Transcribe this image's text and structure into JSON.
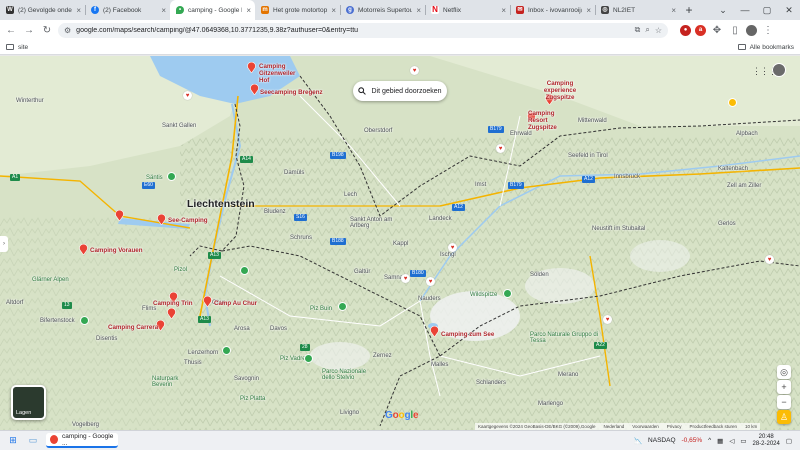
{
  "browser": {
    "tabs": [
      {
        "title": "(2) Gevolgde onderw",
        "favicon": "w-icon",
        "color": "#333333",
        "active": false
      },
      {
        "title": "(2) Facebook",
        "favicon": "facebook-icon",
        "color": "#1877f2",
        "active": false
      },
      {
        "title": "camping - Google M",
        "favicon": "google-maps-icon",
        "color": "#34a853",
        "active": true
      },
      {
        "title": "Het grote motortop",
        "favicon": "motor-icon",
        "color": "#e37400",
        "active": false
      },
      {
        "title": "Motorreis Supertou",
        "favicon": "globe-icon",
        "color": "#4a6fd1",
        "active": false
      },
      {
        "title": "Netflix",
        "favicon": "netflix-icon",
        "color": "#e50914",
        "active": false
      },
      {
        "title": "Inbox - ivovanrooij@",
        "favicon": "mail-icon",
        "color": "#c5221f",
        "active": false
      },
      {
        "title": "NL2IET",
        "favicon": "instagram-icon",
        "color": "#444444",
        "active": false
      }
    ],
    "url": "google.com/maps/search/camping/@47.0649368,10.3771235,9.38z?authuser=0&entry=ttu",
    "bookmarks": {
      "left": "site",
      "right": "Alle bookmarks"
    }
  },
  "map": {
    "search_area_label": "Dit gebied doorzoeken",
    "layers_label": "Lagen",
    "places": [
      {
        "name": "Liechtenstein",
        "kind": "big"
      },
      {
        "name": "Winterthur",
        "kind": "town"
      },
      {
        "name": "Sankt Gallen",
        "kind": "town"
      },
      {
        "name": "Säntis",
        "kind": "park"
      },
      {
        "name": "Oberstdorf",
        "kind": "town"
      },
      {
        "name": "Ehrwald",
        "kind": "town"
      },
      {
        "name": "Mittenwald",
        "kind": "town"
      },
      {
        "name": "Seefeld in Tirol",
        "kind": "town"
      },
      {
        "name": "Innsbruck",
        "kind": "town"
      },
      {
        "name": "Alpbach",
        "kind": "town"
      },
      {
        "name": "Kaltenbach",
        "kind": "town"
      },
      {
        "name": "Zell am Ziller",
        "kind": "town"
      },
      {
        "name": "Neustift im Stubaital",
        "kind": "town"
      },
      {
        "name": "Damüls",
        "kind": "town"
      },
      {
        "name": "Bludenz",
        "kind": "town"
      },
      {
        "name": "Schruns",
        "kind": "town"
      },
      {
        "name": "Sankt Anton am Arlberg",
        "kind": "town"
      },
      {
        "name": "Landeck",
        "kind": "town"
      },
      {
        "name": "Imst",
        "kind": "town"
      },
      {
        "name": "Lech",
        "kind": "town"
      },
      {
        "name": "Kappl",
        "kind": "town"
      },
      {
        "name": "Galtür",
        "kind": "town"
      },
      {
        "name": "Ischgl",
        "kind": "town"
      },
      {
        "name": "Samnaun",
        "kind": "town"
      },
      {
        "name": "Nauders",
        "kind": "town"
      },
      {
        "name": "Sölden",
        "kind": "town"
      },
      {
        "name": "Wildspitze",
        "kind": "park"
      },
      {
        "name": "Gerlos",
        "kind": "town"
      },
      {
        "name": "Merano",
        "kind": "town"
      },
      {
        "name": "Parco Naturale Gruppo di Tessa",
        "kind": "park"
      },
      {
        "name": "Marlengo",
        "kind": "town"
      },
      {
        "name": "Schlanders",
        "kind": "town"
      },
      {
        "name": "Malles",
        "kind": "town"
      },
      {
        "name": "Zernez",
        "kind": "town"
      },
      {
        "name": "Davos",
        "kind": "town"
      },
      {
        "name": "Piz Buin",
        "kind": "park"
      },
      {
        "name": "Piz Vadret",
        "kind": "park"
      },
      {
        "name": "Lenzerhorn",
        "kind": "town"
      },
      {
        "name": "Chur",
        "kind": "town"
      },
      {
        "name": "Flims",
        "kind": "town"
      },
      {
        "name": "Pizol",
        "kind": "park"
      },
      {
        "name": "Glärner Alpen",
        "kind": "park"
      },
      {
        "name": "Bifertenstock",
        "kind": "town"
      },
      {
        "name": "Arosa",
        "kind": "town"
      },
      {
        "name": "Savognin",
        "kind": "town"
      },
      {
        "name": "Naturpark Beverin",
        "kind": "park"
      },
      {
        "name": "Piz Platta",
        "kind": "park"
      },
      {
        "name": "Livigno",
        "kind": "town"
      },
      {
        "name": "Parco Nazionale dello Stelvio",
        "kind": "park"
      },
      {
        "name": "Vogelberg",
        "kind": "town"
      },
      {
        "name": "Thusis",
        "kind": "town"
      },
      {
        "name": "Disentis",
        "kind": "town"
      },
      {
        "name": "Altdorf",
        "kind": "town"
      }
    ],
    "campings": [
      {
        "name": "Camping Gitzenweiler Hof"
      },
      {
        "name": "Seecamping Bregenz"
      },
      {
        "name": "Camping experience Zugspitze"
      },
      {
        "name": "Camping Resort Zugspitze"
      },
      {
        "name": "See-Camping"
      },
      {
        "name": "Camping Vorauen"
      },
      {
        "name": "Camping Trin"
      },
      {
        "name": "Camp Au Chur"
      },
      {
        "name": "Camping Carrera"
      },
      {
        "name": "Camping zum See"
      }
    ],
    "roads": [
      "B179",
      "B179",
      "A12",
      "A12",
      "A13",
      "A13",
      "A14",
      "A1",
      "S16",
      "B180",
      "13",
      "28",
      "E60",
      "B188",
      "B198",
      "A22"
    ],
    "attribution": [
      "Kaartgegevens ©2024 GeoBasis-DE/BKG (©2009),Google",
      "Nederland",
      "Voorwaarden",
      "Privacy",
      "Productfeedback sturen",
      "10 km"
    ]
  },
  "taskbar": {
    "chrome_label": "camping - Google ...",
    "ticker_name": "NASDAQ",
    "ticker_value": "-0,65%",
    "time": "20:48",
    "date": "28-2-2024"
  }
}
